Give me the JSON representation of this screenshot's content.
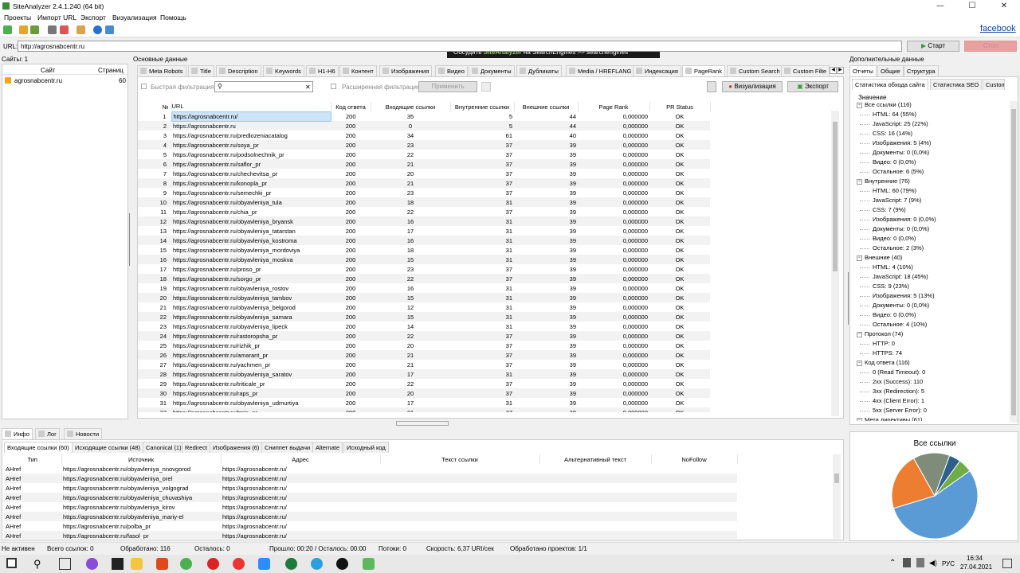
{
  "app": {
    "title": "SiteAnalyzer 2.4.1.240 (64 bit)"
  },
  "window": {
    "minimize": "—",
    "maximize": "☐",
    "close": "✕"
  },
  "menu": [
    "Проекты",
    "Импорт URL",
    "Экспорт",
    "Визуализация",
    "Помощь"
  ],
  "banner": {
    "text1": "Обсудить ",
    "brand": "SiteAnalyzer",
    "text2": " на SearchEngines   >>  searchengines"
  },
  "facebook": "facebook",
  "url": {
    "label": "URL:",
    "value": "http://agrosnabcentr.ru",
    "start": "Старт",
    "stop": "Стоп"
  },
  "sites": {
    "header": "Сайты: 1",
    "col_site": "Сайт",
    "col_pages": "Страниц",
    "rows": [
      {
        "site": "agrosnabcentr.ru",
        "pages": "60"
      }
    ]
  },
  "main": {
    "header": "Основные данные",
    "tabs": [
      "Meta Robots",
      "Title",
      "Description",
      "Keywords",
      "H1-H6",
      "Контент",
      "Изображения",
      "Видео",
      "Документы",
      "Дубликаты",
      "Media / HREFLANG",
      "Индексация",
      "PageRank",
      "Custom Search",
      "Custom Filte"
    ],
    "active_tab": "PageRank",
    "quick_filter": "Быстрая фильтрация:",
    "ext_filter": "Расширенная фильтрация:",
    "apply": "Применить",
    "visualize": "Визуализация",
    "export": "Экспорт",
    "columns": [
      "№",
      "URL",
      "Код ответа",
      "Входящие ссылки",
      "Внутренние ссылки",
      "Внешние ссылки",
      "Page Rank",
      "PR Status"
    ],
    "rows": [
      [
        "1",
        "https://agrosnabcentr.ru/",
        "200",
        "35",
        "5",
        "44",
        "0,000000",
        "OK"
      ],
      [
        "2",
        "https://agrosnabcentr.ru",
        "200",
        "0",
        "5",
        "44",
        "0,000000",
        "OK"
      ],
      [
        "3",
        "https://agrosnabcentr.ru/predlozeniacatalog",
        "200",
        "34",
        "61",
        "40",
        "0,000000",
        "OK"
      ],
      [
        "4",
        "https://agrosnabcentr.ru/soya_pr",
        "200",
        "23",
        "37",
        "39",
        "0,000000",
        "OK"
      ],
      [
        "5",
        "https://agrosnabcentr.ru/podsolnechnik_pr",
        "200",
        "22",
        "37",
        "39",
        "0,000000",
        "OK"
      ],
      [
        "6",
        "https://agrosnabcentr.ru/saflor_pr",
        "200",
        "21",
        "37",
        "39",
        "0,000000",
        "OK"
      ],
      [
        "7",
        "https://agrosnabcentr.ru/chechevitsa_pr",
        "200",
        "20",
        "37",
        "39",
        "0,000000",
        "OK"
      ],
      [
        "8",
        "https://agrosnabcentr.ru/konopla_pr",
        "200",
        "21",
        "37",
        "39",
        "0,000000",
        "OK"
      ],
      [
        "9",
        "https://agrosnabcentr.ru/semechki_pr",
        "200",
        "23",
        "37",
        "39",
        "0,000000",
        "OK"
      ],
      [
        "10",
        "https://agrosnabcentr.ru/obyavleniya_tula",
        "200",
        "18",
        "31",
        "39",
        "0,000000",
        "OK"
      ],
      [
        "11",
        "https://agrosnabcentr.ru/chia_pr",
        "200",
        "22",
        "37",
        "39",
        "0,000000",
        "OK"
      ],
      [
        "12",
        "https://agrosnabcentr.ru/obyavleniya_bryansk",
        "200",
        "16",
        "31",
        "39",
        "0,000000",
        "OK"
      ],
      [
        "13",
        "https://agrosnabcentr.ru/obyavleniya_tatarstan",
        "200",
        "17",
        "31",
        "39",
        "0,000000",
        "OK"
      ],
      [
        "14",
        "https://agrosnabcentr.ru/obyavleniya_kostroma",
        "200",
        "16",
        "31",
        "39",
        "0,000000",
        "OK"
      ],
      [
        "15",
        "https://agrosnabcentr.ru/obyavleniya_mordoviya",
        "200",
        "18",
        "31",
        "39",
        "0,000000",
        "OK"
      ],
      [
        "16",
        "https://agrosnabcentr.ru/obyavleniya_moskva",
        "200",
        "15",
        "31",
        "39",
        "0,000000",
        "OK"
      ],
      [
        "17",
        "https://agrosnabcentr.ru/proso_pr",
        "200",
        "23",
        "37",
        "39",
        "0,000000",
        "OK"
      ],
      [
        "18",
        "https://agrosnabcentr.ru/sorgo_pr",
        "200",
        "22",
        "37",
        "39",
        "0,000000",
        "OK"
      ],
      [
        "19",
        "https://agrosnabcentr.ru/obyavleniya_rostov",
        "200",
        "16",
        "31",
        "39",
        "0,000000",
        "OK"
      ],
      [
        "20",
        "https://agrosnabcentr.ru/obyavleniya_tambov",
        "200",
        "15",
        "31",
        "39",
        "0,000000",
        "OK"
      ],
      [
        "21",
        "https://agrosnabcentr.ru/obyavleniya_belgorod",
        "200",
        "12",
        "31",
        "39",
        "0,000000",
        "OK"
      ],
      [
        "22",
        "https://agrosnabcentr.ru/obyavleniya_samara",
        "200",
        "15",
        "31",
        "39",
        "0,000000",
        "OK"
      ],
      [
        "23",
        "https://agrosnabcentr.ru/obyavleniya_lipeck",
        "200",
        "14",
        "31",
        "39",
        "0,000000",
        "OK"
      ],
      [
        "24",
        "https://agrosnabcentr.ru/rastoropsha_pr",
        "200",
        "22",
        "37",
        "39",
        "0,000000",
        "OK"
      ],
      [
        "25",
        "https://agrosnabcentr.ru/rizhik_pr",
        "200",
        "20",
        "37",
        "39",
        "0,000000",
        "OK"
      ],
      [
        "26",
        "https://agrosnabcentr.ru/amarant_pr",
        "200",
        "21",
        "37",
        "39",
        "0,000000",
        "OK"
      ],
      [
        "27",
        "https://agrosnabcentr.ru/yachmen_pr",
        "200",
        "21",
        "37",
        "39",
        "0,000000",
        "OK"
      ],
      [
        "28",
        "https://agrosnabcentr.ru/obyavleniya_saratov",
        "200",
        "17",
        "31",
        "39",
        "0,000000",
        "OK"
      ],
      [
        "29",
        "https://agrosnabcentr.ru/triticale_pr",
        "200",
        "22",
        "37",
        "39",
        "0,000000",
        "OK"
      ],
      [
        "30",
        "https://agrosnabcentr.ru/raps_pr",
        "200",
        "20",
        "37",
        "39",
        "0,000000",
        "OK"
      ],
      [
        "31",
        "https://agrosnabcentr.ru/obyavleniya_udmurtiya",
        "200",
        "17",
        "31",
        "39",
        "0,000000",
        "OK"
      ],
      [
        "32",
        "https://agrosnabcentr.ru/tmin_pr",
        "200",
        "21",
        "37",
        "39",
        "0,000000",
        "OK"
      ]
    ]
  },
  "bottom": {
    "tabs1": [
      "Инфо",
      "Лог",
      "Новости"
    ],
    "tabs2": [
      "Входящие ссылки (60)",
      "Исходящие ссылки (48)",
      "Canonical (1)",
      "Redirect",
      "Изображения (6)",
      "Сниппет выдачи",
      "Alternate",
      "Исходный код"
    ],
    "columns": [
      "Тип",
      "Источник",
      "Адрес",
      "Текст ссылки",
      "Альтернативный текст",
      "NoFollow"
    ],
    "rows": [
      [
        "AHref",
        "https://agrosnabcentr.ru/obyavleniya_nnovgorod",
        "https://agrosnabcentr.ru/"
      ],
      [
        "AHref",
        "https://agrosnabcentr.ru/obyavleniya_orel",
        "https://agrosnabcentr.ru/"
      ],
      [
        "AHref",
        "https://agrosnabcentr.ru/obyavleniya_volgograd",
        "https://agrosnabcentr.ru/"
      ],
      [
        "AHref",
        "https://agrosnabcentr.ru/obyavleniya_chuvashiya",
        "https://agrosnabcentr.ru/"
      ],
      [
        "AHref",
        "https://agrosnabcentr.ru/obyavleniya_kirov",
        "https://agrosnabcentr.ru/"
      ],
      [
        "AHref",
        "https://agrosnabcentr.ru/obyavleniya_mariy-el",
        "https://agrosnabcentr.ru/"
      ],
      [
        "AHref",
        "https://agrosnabcentr.ru/polba_pr",
        "https://agrosnabcentr.ru/"
      ],
      [
        "AHref",
        "https://agrosnabcentr.ru/fasol_pr",
        "https://agrosnabcentr.ru/"
      ]
    ]
  },
  "right": {
    "header": "Дополнительные данные",
    "tabs": [
      "Отчеты",
      "Общие",
      "Структура"
    ],
    "subtabs": [
      "Статистика обхода сайта",
      "Статистика SEO",
      "Custom"
    ],
    "col": "Значение",
    "tree": [
      {
        "t": "Все ссылки (116)",
        "l": 0
      },
      {
        "t": "HTML: 64 (55%)",
        "l": 1
      },
      {
        "t": "JavaScript: 25 (22%)",
        "l": 1
      },
      {
        "t": "CSS: 16 (14%)",
        "l": 1
      },
      {
        "t": "Изображения: 5 (4%)",
        "l": 1
      },
      {
        "t": "Документы: 0 (0,0%)",
        "l": 1
      },
      {
        "t": "Видео: 0 (0,0%)",
        "l": 1
      },
      {
        "t": "Остальное: 6 (5%)",
        "l": 1
      },
      {
        "t": "Внутренние (76)",
        "l": 0
      },
      {
        "t": "HTML: 60 (79%)",
        "l": 1
      },
      {
        "t": "JavaScript: 7 (9%)",
        "l": 1
      },
      {
        "t": "CSS: 7 (9%)",
        "l": 1
      },
      {
        "t": "Изображения: 0 (0,0%)",
        "l": 1
      },
      {
        "t": "Документы: 0 (0,0%)",
        "l": 1
      },
      {
        "t": "Видео: 0 (0,0%)",
        "l": 1
      },
      {
        "t": "Остальное: 2 (3%)",
        "l": 1
      },
      {
        "t": "Внешние (40)",
        "l": 0
      },
      {
        "t": "HTML: 4 (10%)",
        "l": 1
      },
      {
        "t": "JavaScript: 18 (45%)",
        "l": 1
      },
      {
        "t": "CSS: 9 (23%)",
        "l": 1
      },
      {
        "t": "Изображения: 5 (13%)",
        "l": 1
      },
      {
        "t": "Документы: 0 (0,0%)",
        "l": 1
      },
      {
        "t": "Видео: 0 (0,0%)",
        "l": 1
      },
      {
        "t": "Остальное: 4 (10%)",
        "l": 1
      },
      {
        "t": "Протокол (74)",
        "l": 0
      },
      {
        "t": "HTTP: 0",
        "l": 1
      },
      {
        "t": "HTTPS: 74",
        "l": 1
      },
      {
        "t": "Код ответа (116)",
        "l": 0
      },
      {
        "t": "0 (Read Timeout): 0",
        "l": 1
      },
      {
        "t": "2xx (Success): 110",
        "l": 1
      },
      {
        "t": "3xx (Redirection): 5",
        "l": 1
      },
      {
        "t": "4xx (Client Error): 1",
        "l": 1
      },
      {
        "t": "5xx (Server Error): 0",
        "l": 1
      },
      {
        "t": "Мета директивы (61)",
        "l": 0
      }
    ],
    "chart_title": "Все ссылки"
  },
  "chart_data": {
    "type": "pie",
    "title": "Все ссылки",
    "categories": [
      "HTML",
      "JavaScript",
      "CSS",
      "Изображения",
      "Документы",
      "Видео",
      "Остальное"
    ],
    "values": [
      64,
      25,
      16,
      5,
      0,
      0,
      6
    ],
    "colors": [
      "#5b9bd5",
      "#ed7d31",
      "#7f8c7a",
      "#2e5f8c",
      "#ffc000",
      "#a5a5a5",
      "#70ad47"
    ]
  },
  "status": [
    "Не активен",
    "Всего ссылок: 0",
    "Обработано: 116",
    "Осталось: 0",
    "Прошло: 00:20 / Осталось: 00:00",
    "Потоки: 0",
    "Скорость: 6,37 URI/сек",
    "Обработано проектов: 1/1"
  ],
  "taskbar": {
    "lang": "РУС",
    "time": "16:34",
    "date": "27.04.2021"
  }
}
